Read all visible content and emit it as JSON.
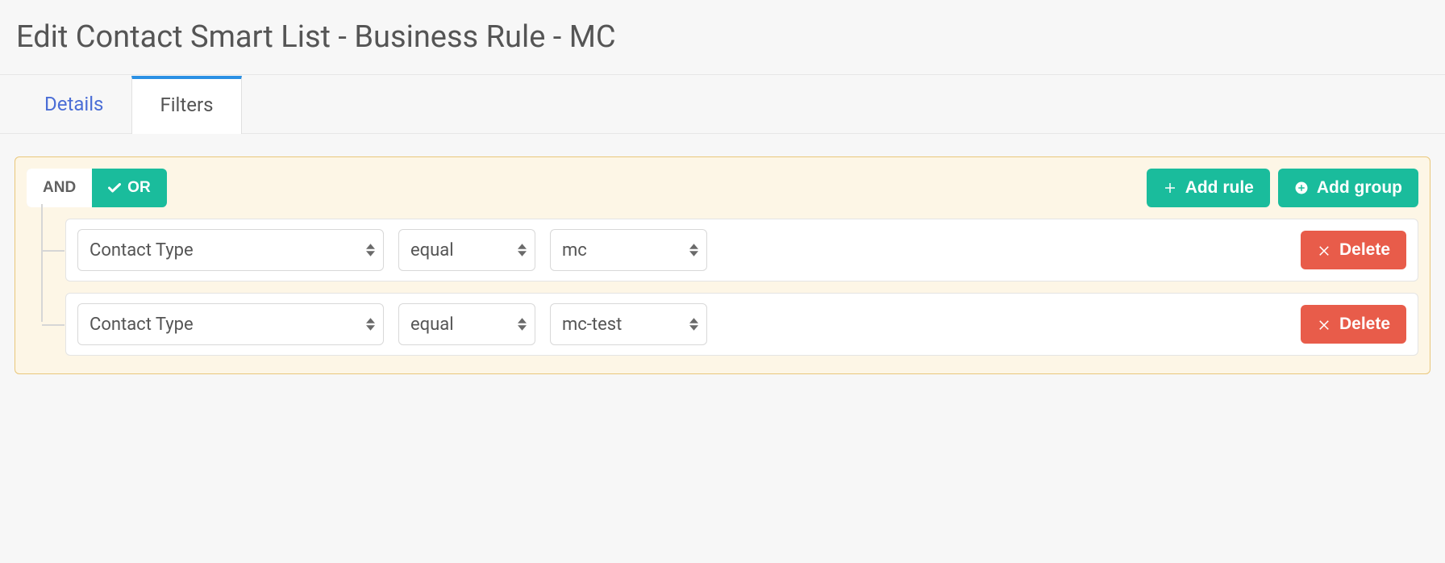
{
  "title": "Edit Contact Smart List - Business Rule - MC",
  "tabs": {
    "details": "Details",
    "filters": "Filters",
    "active": "filters"
  },
  "colors": {
    "accent": "#1abc9c",
    "danger": "#e85c4a",
    "tab_accent": "#2b90e4",
    "group_bg": "#fdf6e6",
    "group_border": "#e9c77b"
  },
  "builder": {
    "conjunction": {
      "and_label": "AND",
      "or_label": "OR",
      "active": "or"
    },
    "actions": {
      "add_rule": "Add rule",
      "add_group": "Add group",
      "delete": "Delete"
    },
    "rules": [
      {
        "field": "Contact Type",
        "operator": "equal",
        "value": "mc"
      },
      {
        "field": "Contact Type",
        "operator": "equal",
        "value": "mc-test"
      }
    ]
  }
}
